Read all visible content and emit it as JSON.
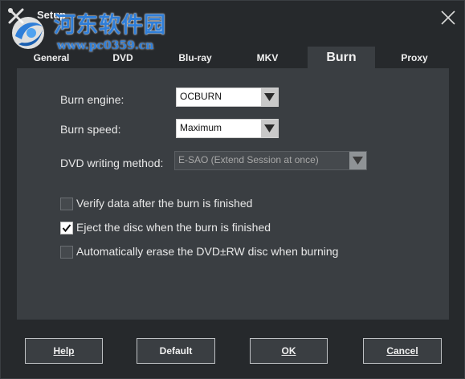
{
  "window": {
    "title": "Setup"
  },
  "watermark": {
    "text": "河东软件园",
    "url": "www.pc0359.cn"
  },
  "tabs": [
    {
      "label": "General",
      "active": false
    },
    {
      "label": "DVD",
      "active": false
    },
    {
      "label": "Blu-ray",
      "active": false
    },
    {
      "label": "MKV",
      "active": false
    },
    {
      "label": "Burn",
      "active": true
    },
    {
      "label": "Proxy",
      "active": false
    }
  ],
  "burn": {
    "engine": {
      "label": "Burn engine:",
      "value": "OCBURN"
    },
    "speed": {
      "label": "Burn speed:",
      "value": "Maximum"
    },
    "method": {
      "label": "DVD writing method:",
      "value": "E-SAO (Extend Session at once)",
      "disabled": true
    },
    "options": [
      {
        "label": "Verify data after the burn is finished",
        "checked": false
      },
      {
        "label": "Eject the disc when the burn is finished",
        "checked": true
      },
      {
        "label": "Automatically erase the DVD±RW disc when burning",
        "checked": false
      }
    ]
  },
  "buttons": {
    "help": "Help",
    "default": "Default",
    "ok": "OK",
    "cancel": "Cancel"
  },
  "colors": {
    "background": "#26292c",
    "panel": "#3a3e42",
    "watermark": "#2f7ed8"
  },
  "icons": {
    "app": "wrench-screwdriver-icon",
    "close": "close-icon",
    "dropdown": "triangle-down-icon",
    "check": "checkmark-icon"
  }
}
